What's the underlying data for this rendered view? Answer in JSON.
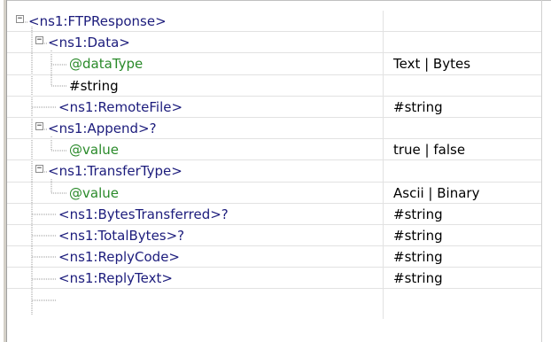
{
  "tree": {
    "root": {
      "label": "<ns1:FTPResponse>",
      "value": ""
    },
    "rows": [
      {
        "label": "<ns1:Data>",
        "value": ""
      },
      {
        "label": "@dataType",
        "value": "Text | Bytes"
      },
      {
        "label": "#string",
        "value": ""
      },
      {
        "label": "<ns1:RemoteFile>",
        "value": "#string"
      },
      {
        "label": "<ns1:Append>?",
        "value": ""
      },
      {
        "label": "@value",
        "value": "true | false"
      },
      {
        "label": "<ns1:TransferType>",
        "value": ""
      },
      {
        "label": "@value",
        "value": "Ascii | Binary"
      },
      {
        "label": "<ns1:BytesTransferred>?",
        "value": "#string"
      },
      {
        "label": "<ns1:TotalBytes>?",
        "value": "#string"
      },
      {
        "label": "<ns1:ReplyCode>",
        "value": "#string"
      },
      {
        "label": "<ns1:ReplyText>",
        "value": "#string"
      }
    ],
    "expander_symbol": "−"
  },
  "colors": {
    "element": "#1c1c7c",
    "attribute": "#2a8a2a",
    "text": "#000000",
    "grid_line": "#e2e2e2"
  }
}
